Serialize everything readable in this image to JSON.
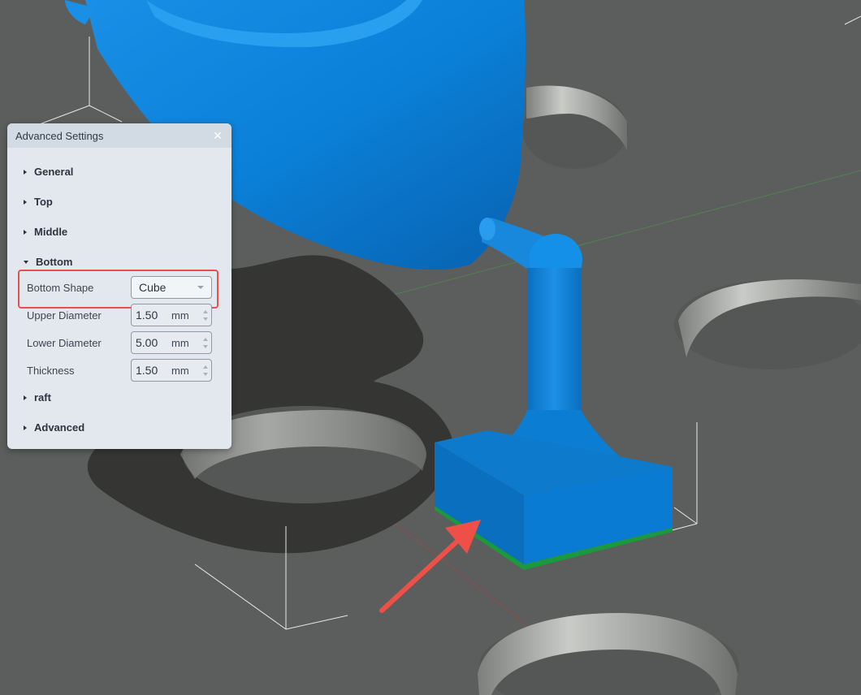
{
  "panel": {
    "title": "Advanced Settings",
    "sections": [
      {
        "label": "General",
        "expanded": false
      },
      {
        "label": "Top",
        "expanded": false
      },
      {
        "label": "Middle",
        "expanded": false
      },
      {
        "label": "Bottom",
        "expanded": true
      },
      {
        "label": "raft",
        "expanded": false
      },
      {
        "label": "Advanced",
        "expanded": false
      }
    ],
    "bottom": {
      "shape_label": "Bottom Shape",
      "shape_value": "Cube",
      "upper_diameter_label": "Upper Diameter",
      "upper_diameter_value": "1.50",
      "lower_diameter_label": "Lower Diameter",
      "lower_diameter_value": "5.00",
      "thickness_label": "Thickness",
      "thickness_value": "1.50",
      "unit": "mm"
    }
  },
  "colors": {
    "viewport_bg": "#5b5e5c",
    "model_blue": "#0a7fd6",
    "highlight": "#ea4f4f",
    "arrow": "#ee5048"
  }
}
